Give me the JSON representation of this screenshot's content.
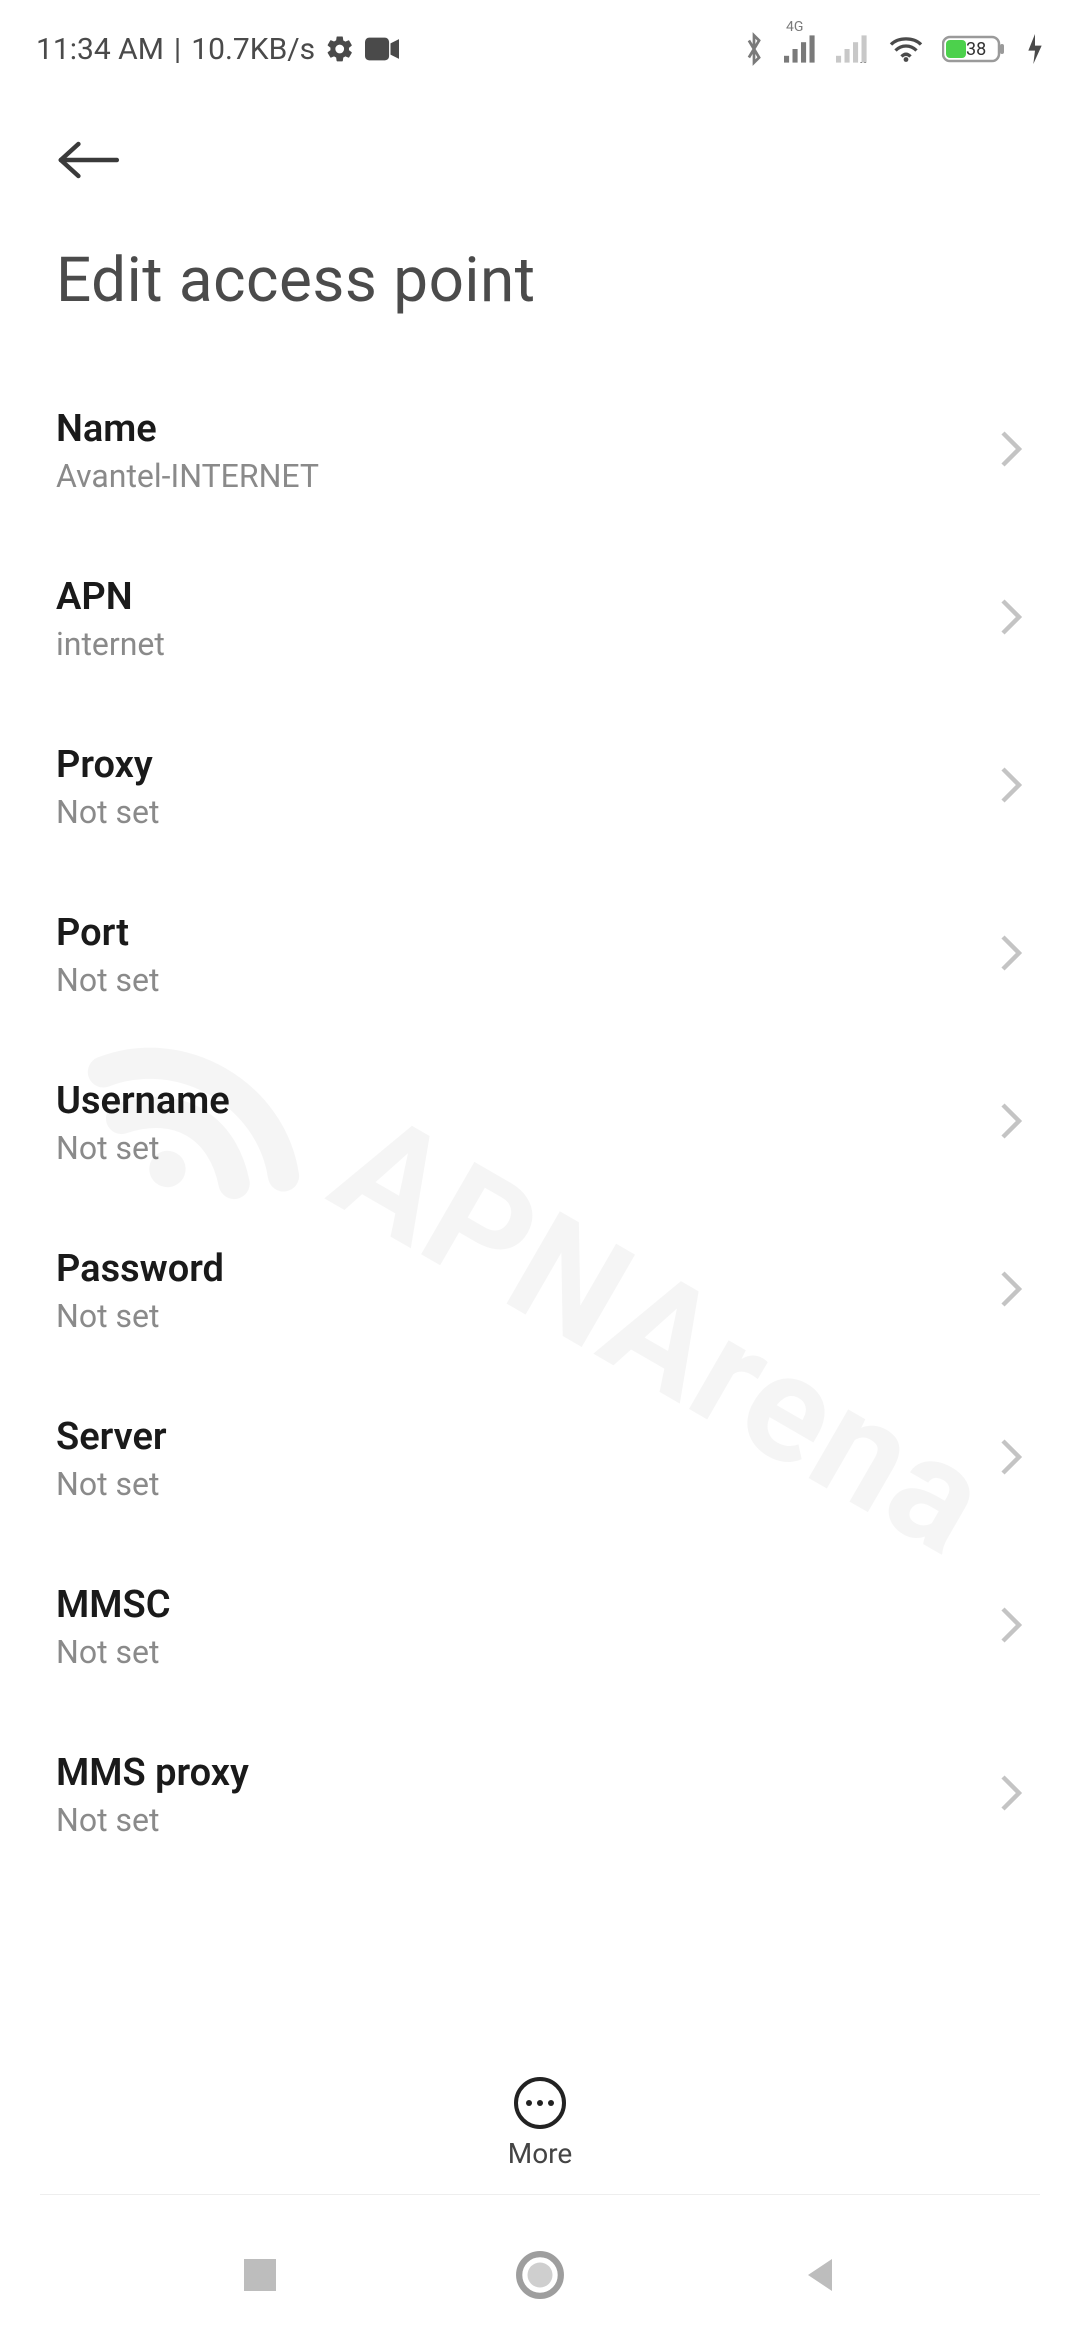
{
  "status": {
    "time": "11:34 AM",
    "net_speed": "10.7KB/s",
    "network_badge": "4G",
    "battery": "38"
  },
  "header": {
    "title": "Edit access point"
  },
  "items": [
    {
      "label": "Name",
      "value": "Avantel-INTERNET"
    },
    {
      "label": "APN",
      "value": "internet"
    },
    {
      "label": "Proxy",
      "value": "Not set"
    },
    {
      "label": "Port",
      "value": "Not set"
    },
    {
      "label": "Username",
      "value": "Not set"
    },
    {
      "label": "Password",
      "value": "Not set"
    },
    {
      "label": "Server",
      "value": "Not set"
    },
    {
      "label": "MMSC",
      "value": "Not set"
    },
    {
      "label": "MMS proxy",
      "value": "Not set"
    }
  ],
  "bottom": {
    "more_label": "More"
  },
  "watermark": {
    "text": "APNArena"
  }
}
